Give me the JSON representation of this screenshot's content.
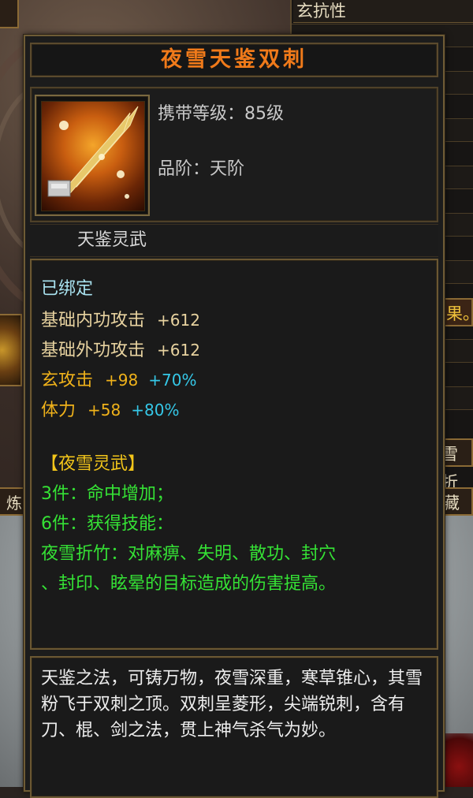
{
  "item": {
    "name": "夜雪天鉴双刺",
    "level_label": "携带等级：85级",
    "grade_label": "品阶：天阶",
    "category": "天鉴灵武",
    "bind_status": "已绑定",
    "stats": [
      {
        "name": "基础内功攻击",
        "value": "+612",
        "bonus": ""
      },
      {
        "name": "基础外功攻击",
        "value": "+612",
        "bonus": ""
      },
      {
        "name": "玄攻击",
        "value": "+98",
        "bonus": "+70%"
      },
      {
        "name": "体力",
        "value": "+58",
        "bonus": "+80%"
      }
    ],
    "set": {
      "title": "【夜雪灵武】",
      "line1": "3件：命中增加；",
      "line2": "6件：获得技能：",
      "line3": "夜雪折竹：对麻痹、失明、散功、封穴",
      "line4": "、封印、眩晕的目标造成的伤害提高。"
    },
    "description": "天鉴之法，可铸万物，夜雪深重，寒草锥心，其雪粉飞于双刺之顶。双刺呈菱形，尖端锐刺，含有刀、棍、剑之法，贯上神气杀气为妙。"
  },
  "background": {
    "side_title": "玄抗性",
    "side_fruit": "果。",
    "side_zhe": "雪折",
    "side_cang": "藏",
    "left_lian": "炼"
  },
  "colors": {
    "title": "#f07a1a",
    "bind": "#a9e3f0",
    "base_stat": "#e8d3a0",
    "xuan_stat": "#f0b21a",
    "bonus": "#35c8e8",
    "set_title": "#f2c51a",
    "set_text": "#35e235",
    "desc": "#ededed"
  }
}
